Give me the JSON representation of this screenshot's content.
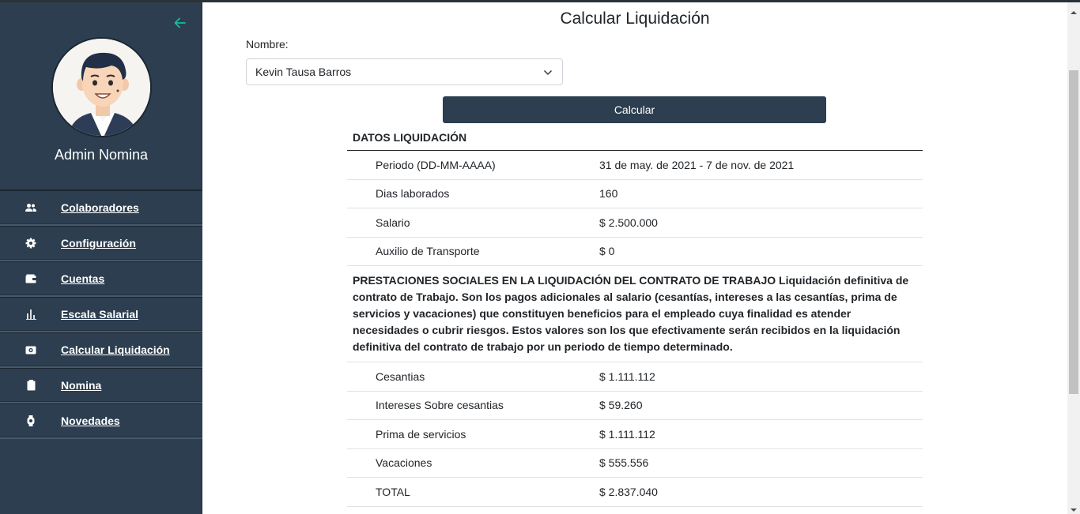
{
  "sidebar": {
    "user_name": "Admin Nomina",
    "items": [
      {
        "label": "Colaboradores",
        "icon": "users-icon"
      },
      {
        "label": "Configuración",
        "icon": "gear-icon"
      },
      {
        "label": "Cuentas",
        "icon": "wallet-icon"
      },
      {
        "label": "Escala Salarial",
        "icon": "bar-chart-icon"
      },
      {
        "label": "Calcular Liquidación",
        "icon": "money-icon"
      },
      {
        "label": "Nomina",
        "icon": "clipboard-icon"
      },
      {
        "label": "Novedades",
        "icon": "watch-icon"
      }
    ]
  },
  "page": {
    "title": "Calcular Liquidación",
    "nombre_label": "Nombre:",
    "selected_employee": "Kevin Tausa Barros",
    "calc_button": "Calcular"
  },
  "table": {
    "header": "DATOS LIQUIDACIÓN",
    "datos": [
      {
        "label": "Periodo (DD-MM-AAAA)",
        "value": "31 de may. de 2021 - 7 de nov. de 2021"
      },
      {
        "label": "Dias laborados",
        "value": "160"
      },
      {
        "label": "Salario",
        "value": "$ 2.500.000"
      },
      {
        "label": "Auxilio de Transporte",
        "value": "$ 0"
      }
    ],
    "prestaciones_text": "PRESTACIONES SOCIALES EN LA LIQUIDACIÓN DEL CONTRATO DE TRABAJO Liquidación definitiva de contrato de Trabajo. Son los pagos adicionales al salario (cesantías, intereses a las cesantías, prima de servicios y vacaciones) que constituyen beneficios para el empleado cuya finalidad es atender necesidades o cubrir riesgos. Estos valores son los que efectivamente serán recibidos en la liquidación definitiva del contrato de trabajo por un periodo de tiempo determinado.",
    "prestaciones": [
      {
        "label": "Cesantias",
        "value": "$ 1.111.112"
      },
      {
        "label": "Intereses Sobre cesantias",
        "value": "$ 59.260"
      },
      {
        "label": "Prima de servicios",
        "value": "$ 1.111.112"
      },
      {
        "label": "Vacaciones",
        "value": "$ 555.556"
      },
      {
        "label": "TOTAL",
        "value": "$ 2.837.040"
      }
    ]
  },
  "colors": {
    "sidebar_bg": "#2c3e50",
    "accent_arrow": "#1abc9c",
    "button_bg": "#2c3e50"
  }
}
